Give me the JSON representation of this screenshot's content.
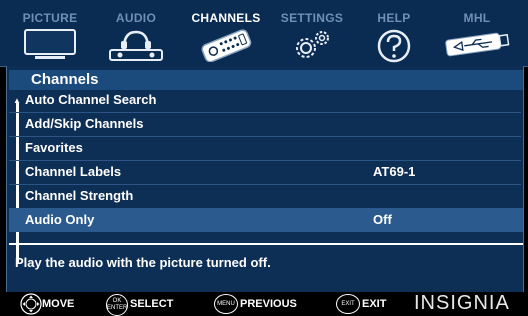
{
  "tabs": [
    {
      "label": "PICTURE",
      "icon": "tv-icon"
    },
    {
      "label": "AUDIO",
      "icon": "headphones-icon"
    },
    {
      "label": "CHANNELS",
      "icon": "remote-icon"
    },
    {
      "label": "SETTINGS",
      "icon": "gears-icon"
    },
    {
      "label": "HELP",
      "icon": "question-icon"
    },
    {
      "label": "MHL",
      "icon": "usb-stick-icon"
    }
  ],
  "active_tab": "CHANNELS",
  "panel": {
    "title": "Channels",
    "items": [
      {
        "label": "Auto Channel Search",
        "value": ""
      },
      {
        "label": "Add/Skip Channels",
        "value": ""
      },
      {
        "label": "Favorites",
        "value": ""
      },
      {
        "label": "Channel Labels",
        "value": "AT69-1"
      },
      {
        "label": "Channel Strength",
        "value": ""
      },
      {
        "label": "Audio Only",
        "value": "Off"
      }
    ],
    "selected_index": 5,
    "help_text": "Play the audio with the picture turned off."
  },
  "footer": {
    "move": "MOVE",
    "ok_top": "OK",
    "ok_bottom": "ENTER",
    "select": "SELECT",
    "menu_btn": "MENU",
    "previous": "PREVIOUS",
    "exit_btn": "EXIT",
    "exit": "EXIT",
    "brand": "INSIGNIA"
  }
}
